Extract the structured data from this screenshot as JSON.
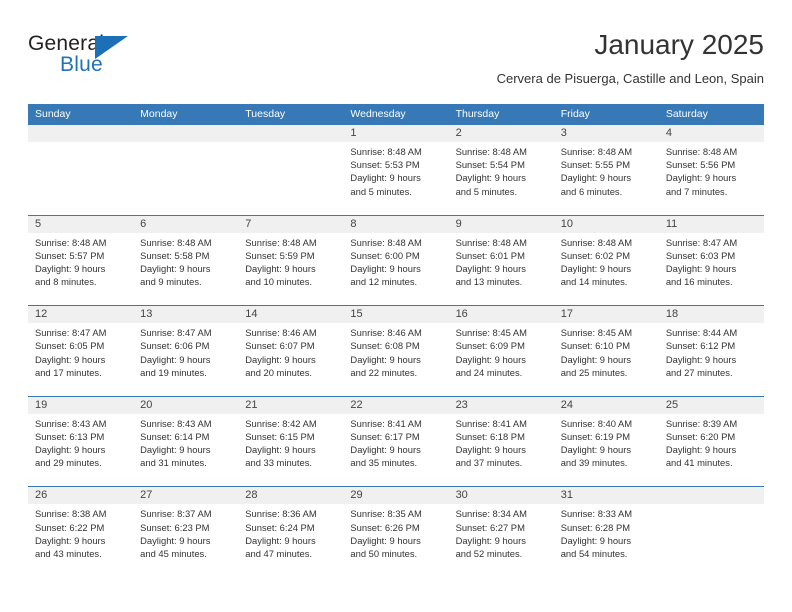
{
  "brand": {
    "name_part1": "General",
    "name_part2": "Blue",
    "color_dark": "#231f20",
    "color_blue": "#2272b8"
  },
  "header": {
    "title": "January 2025",
    "subtitle": "Cervera de Pisuerga, Castille and Leon, Spain"
  },
  "theme": {
    "header_bg": "#3679b6",
    "day_strip_bg": "#f0f0f0",
    "row_border": "#3679b6"
  },
  "weekdays": [
    "Sunday",
    "Monday",
    "Tuesday",
    "Wednesday",
    "Thursday",
    "Friday",
    "Saturday"
  ],
  "weeks": [
    [
      {
        "day": "",
        "sunrise": "",
        "sunset": "",
        "daylight_line1": "",
        "daylight_line2": ""
      },
      {
        "day": "",
        "sunrise": "",
        "sunset": "",
        "daylight_line1": "",
        "daylight_line2": ""
      },
      {
        "day": "",
        "sunrise": "",
        "sunset": "",
        "daylight_line1": "",
        "daylight_line2": ""
      },
      {
        "day": "1",
        "sunrise": "Sunrise: 8:48 AM",
        "sunset": "Sunset: 5:53 PM",
        "daylight_line1": "Daylight: 9 hours",
        "daylight_line2": "and 5 minutes."
      },
      {
        "day": "2",
        "sunrise": "Sunrise: 8:48 AM",
        "sunset": "Sunset: 5:54 PM",
        "daylight_line1": "Daylight: 9 hours",
        "daylight_line2": "and 5 minutes."
      },
      {
        "day": "3",
        "sunrise": "Sunrise: 8:48 AM",
        "sunset": "Sunset: 5:55 PM",
        "daylight_line1": "Daylight: 9 hours",
        "daylight_line2": "and 6 minutes."
      },
      {
        "day": "4",
        "sunrise": "Sunrise: 8:48 AM",
        "sunset": "Sunset: 5:56 PM",
        "daylight_line1": "Daylight: 9 hours",
        "daylight_line2": "and 7 minutes."
      }
    ],
    [
      {
        "day": "5",
        "sunrise": "Sunrise: 8:48 AM",
        "sunset": "Sunset: 5:57 PM",
        "daylight_line1": "Daylight: 9 hours",
        "daylight_line2": "and 8 minutes."
      },
      {
        "day": "6",
        "sunrise": "Sunrise: 8:48 AM",
        "sunset": "Sunset: 5:58 PM",
        "daylight_line1": "Daylight: 9 hours",
        "daylight_line2": "and 9 minutes."
      },
      {
        "day": "7",
        "sunrise": "Sunrise: 8:48 AM",
        "sunset": "Sunset: 5:59 PM",
        "daylight_line1": "Daylight: 9 hours",
        "daylight_line2": "and 10 minutes."
      },
      {
        "day": "8",
        "sunrise": "Sunrise: 8:48 AM",
        "sunset": "Sunset: 6:00 PM",
        "daylight_line1": "Daylight: 9 hours",
        "daylight_line2": "and 12 minutes."
      },
      {
        "day": "9",
        "sunrise": "Sunrise: 8:48 AM",
        "sunset": "Sunset: 6:01 PM",
        "daylight_line1": "Daylight: 9 hours",
        "daylight_line2": "and 13 minutes."
      },
      {
        "day": "10",
        "sunrise": "Sunrise: 8:48 AM",
        "sunset": "Sunset: 6:02 PM",
        "daylight_line1": "Daylight: 9 hours",
        "daylight_line2": "and 14 minutes."
      },
      {
        "day": "11",
        "sunrise": "Sunrise: 8:47 AM",
        "sunset": "Sunset: 6:03 PM",
        "daylight_line1": "Daylight: 9 hours",
        "daylight_line2": "and 16 minutes."
      }
    ],
    [
      {
        "day": "12",
        "sunrise": "Sunrise: 8:47 AM",
        "sunset": "Sunset: 6:05 PM",
        "daylight_line1": "Daylight: 9 hours",
        "daylight_line2": "and 17 minutes."
      },
      {
        "day": "13",
        "sunrise": "Sunrise: 8:47 AM",
        "sunset": "Sunset: 6:06 PM",
        "daylight_line1": "Daylight: 9 hours",
        "daylight_line2": "and 19 minutes."
      },
      {
        "day": "14",
        "sunrise": "Sunrise: 8:46 AM",
        "sunset": "Sunset: 6:07 PM",
        "daylight_line1": "Daylight: 9 hours",
        "daylight_line2": "and 20 minutes."
      },
      {
        "day": "15",
        "sunrise": "Sunrise: 8:46 AM",
        "sunset": "Sunset: 6:08 PM",
        "daylight_line1": "Daylight: 9 hours",
        "daylight_line2": "and 22 minutes."
      },
      {
        "day": "16",
        "sunrise": "Sunrise: 8:45 AM",
        "sunset": "Sunset: 6:09 PM",
        "daylight_line1": "Daylight: 9 hours",
        "daylight_line2": "and 24 minutes."
      },
      {
        "day": "17",
        "sunrise": "Sunrise: 8:45 AM",
        "sunset": "Sunset: 6:10 PM",
        "daylight_line1": "Daylight: 9 hours",
        "daylight_line2": "and 25 minutes."
      },
      {
        "day": "18",
        "sunrise": "Sunrise: 8:44 AM",
        "sunset": "Sunset: 6:12 PM",
        "daylight_line1": "Daylight: 9 hours",
        "daylight_line2": "and 27 minutes."
      }
    ],
    [
      {
        "day": "19",
        "sunrise": "Sunrise: 8:43 AM",
        "sunset": "Sunset: 6:13 PM",
        "daylight_line1": "Daylight: 9 hours",
        "daylight_line2": "and 29 minutes."
      },
      {
        "day": "20",
        "sunrise": "Sunrise: 8:43 AM",
        "sunset": "Sunset: 6:14 PM",
        "daylight_line1": "Daylight: 9 hours",
        "daylight_line2": "and 31 minutes."
      },
      {
        "day": "21",
        "sunrise": "Sunrise: 8:42 AM",
        "sunset": "Sunset: 6:15 PM",
        "daylight_line1": "Daylight: 9 hours",
        "daylight_line2": "and 33 minutes."
      },
      {
        "day": "22",
        "sunrise": "Sunrise: 8:41 AM",
        "sunset": "Sunset: 6:17 PM",
        "daylight_line1": "Daylight: 9 hours",
        "daylight_line2": "and 35 minutes."
      },
      {
        "day": "23",
        "sunrise": "Sunrise: 8:41 AM",
        "sunset": "Sunset: 6:18 PM",
        "daylight_line1": "Daylight: 9 hours",
        "daylight_line2": "and 37 minutes."
      },
      {
        "day": "24",
        "sunrise": "Sunrise: 8:40 AM",
        "sunset": "Sunset: 6:19 PM",
        "daylight_line1": "Daylight: 9 hours",
        "daylight_line2": "and 39 minutes."
      },
      {
        "day": "25",
        "sunrise": "Sunrise: 8:39 AM",
        "sunset": "Sunset: 6:20 PM",
        "daylight_line1": "Daylight: 9 hours",
        "daylight_line2": "and 41 minutes."
      }
    ],
    [
      {
        "day": "26",
        "sunrise": "Sunrise: 8:38 AM",
        "sunset": "Sunset: 6:22 PM",
        "daylight_line1": "Daylight: 9 hours",
        "daylight_line2": "and 43 minutes."
      },
      {
        "day": "27",
        "sunrise": "Sunrise: 8:37 AM",
        "sunset": "Sunset: 6:23 PM",
        "daylight_line1": "Daylight: 9 hours",
        "daylight_line2": "and 45 minutes."
      },
      {
        "day": "28",
        "sunrise": "Sunrise: 8:36 AM",
        "sunset": "Sunset: 6:24 PM",
        "daylight_line1": "Daylight: 9 hours",
        "daylight_line2": "and 47 minutes."
      },
      {
        "day": "29",
        "sunrise": "Sunrise: 8:35 AM",
        "sunset": "Sunset: 6:26 PM",
        "daylight_line1": "Daylight: 9 hours",
        "daylight_line2": "and 50 minutes."
      },
      {
        "day": "30",
        "sunrise": "Sunrise: 8:34 AM",
        "sunset": "Sunset: 6:27 PM",
        "daylight_line1": "Daylight: 9 hours",
        "daylight_line2": "and 52 minutes."
      },
      {
        "day": "31",
        "sunrise": "Sunrise: 8:33 AM",
        "sunset": "Sunset: 6:28 PM",
        "daylight_line1": "Daylight: 9 hours",
        "daylight_line2": "and 54 minutes."
      },
      {
        "day": "",
        "sunrise": "",
        "sunset": "",
        "daylight_line1": "",
        "daylight_line2": ""
      }
    ]
  ]
}
